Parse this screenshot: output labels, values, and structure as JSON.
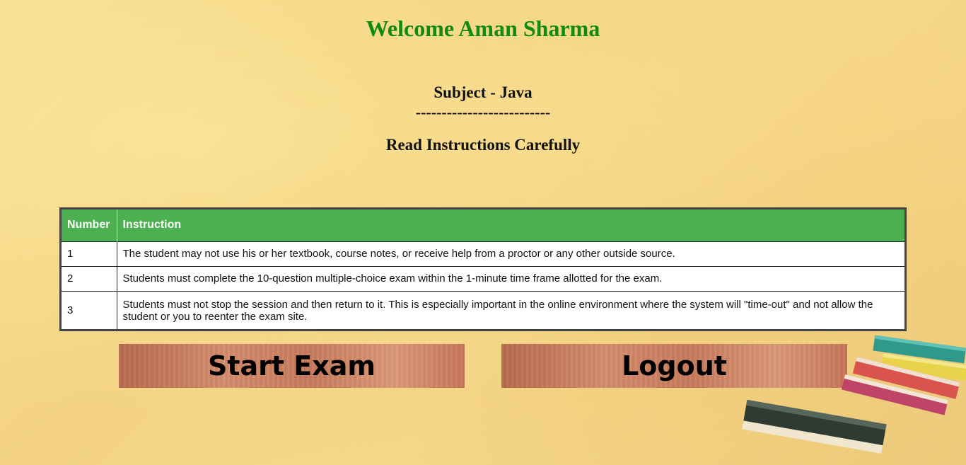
{
  "header": {
    "welcome": "Welcome Aman Sharma",
    "subject": "Subject - Java",
    "divider": "--------------------------",
    "instructions_heading": "Read Instructions Carefully"
  },
  "table": {
    "columns": [
      "Number",
      "Instruction"
    ],
    "rows": [
      {
        "number": "1",
        "instruction": "The student may not use his or her textbook, course notes, or receive help from a proctor or any other outside source."
      },
      {
        "number": "2",
        "instruction": "Students must complete the 10-question multiple-choice exam within the 1-minute time frame allotted for the exam."
      },
      {
        "number": "3",
        "instruction": "Students must not stop the session and then return to it. This is especially important in the online environment where the system will \"time-out\" and not allow the student or you to reenter the exam site."
      }
    ]
  },
  "actions": {
    "start_label": "Start Exam",
    "logout_label": "Logout"
  },
  "colors": {
    "welcome_text": "#118a11",
    "table_header": "#4caf50",
    "background": "#f5d688",
    "button": "#cc8062"
  }
}
